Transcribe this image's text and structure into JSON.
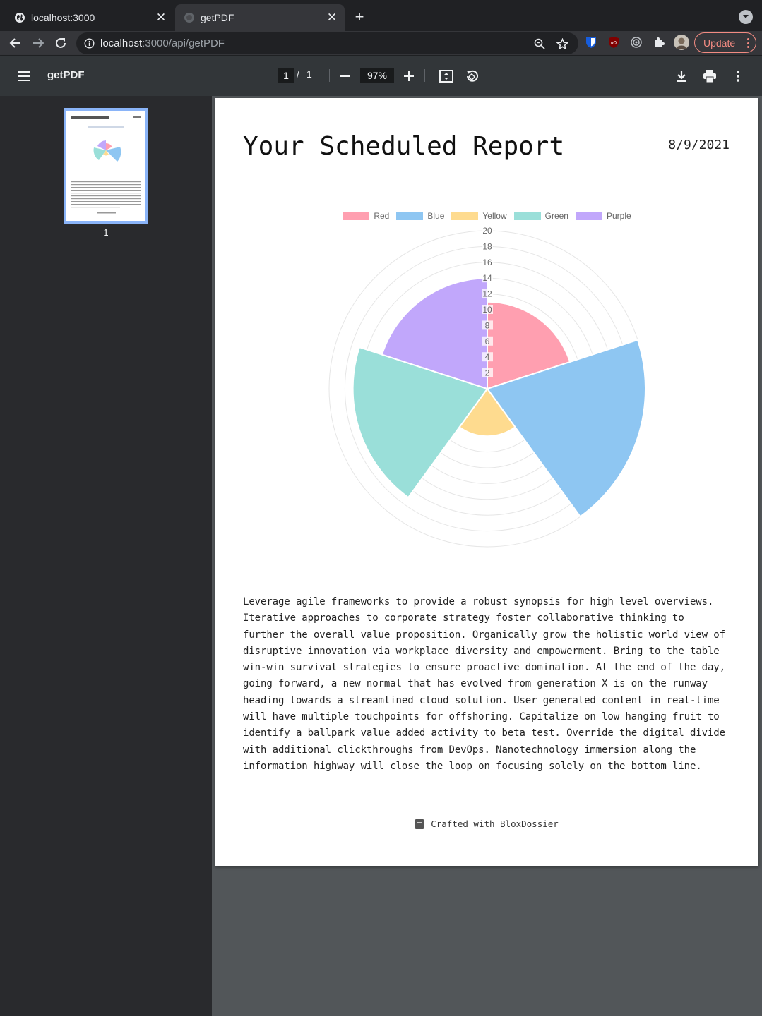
{
  "browser": {
    "tabs": [
      {
        "title": "localhost:3000",
        "active": false
      },
      {
        "title": "getPDF",
        "active": true
      }
    ],
    "url_host": "localhost",
    "url_rest": ":3000/api/getPDF",
    "update_label": "Update"
  },
  "pdf_toolbar": {
    "title": "getPDF",
    "current_page": "1",
    "page_separator": "/",
    "total_pages": "1",
    "zoom": "97%"
  },
  "sidebar": {
    "thumbnail_number": "1"
  },
  "report": {
    "title": "Your Scheduled Report",
    "date": "8/9/2021",
    "body": "Leverage agile frameworks to provide a robust synopsis for high level overviews. Iterative approaches to corporate strategy foster collaborative thinking to further the overall value proposition. Organically grow the holistic world view of disruptive innovation via workplace diversity and empowerment. Bring to the table win-win survival strategies to ensure proactive domination. At the end of the day, going forward, a new normal that has evolved from generation X is on the runway heading towards a streamlined cloud solution. User generated content in real-time will have multiple touchpoints for offshoring. Capitalize on low hanging fruit to identify a ballpark value added activity to beta test. Override the digital divide with additional clickthroughs from DevOps. Nanotechnology immersion along the information highway will close the loop on focusing solely on the bottom line.",
    "footer": "Crafted with BloxDossier"
  },
  "chart_data": {
    "type": "polarArea",
    "categories": [
      "Red",
      "Blue",
      "Yellow",
      "Green",
      "Purple"
    ],
    "values": [
      11,
      20,
      6,
      17,
      14
    ],
    "colors": [
      "#ff9fb0",
      "#8ec6f2",
      "#fedb8f",
      "#9adfd9",
      "#c1a7fb"
    ],
    "r_ticks": [
      "2",
      "4",
      "6",
      "8",
      "10",
      "12",
      "14",
      "16",
      "18",
      "20"
    ],
    "r_range": [
      0,
      20
    ],
    "legend_position": "top",
    "grid": true
  },
  "colors": {
    "accent": "#8ab4f8",
    "update": "#f28b82"
  }
}
